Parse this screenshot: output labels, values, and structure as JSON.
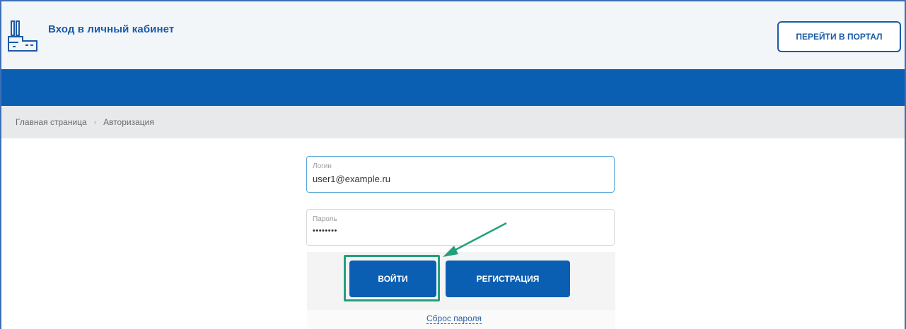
{
  "header": {
    "title": "Вход в личный кабинет",
    "portal_button": "ПЕРЕЙТИ В ПОРТАЛ"
  },
  "breadcrumb": {
    "home": "Главная страница",
    "separator": "›",
    "current": "Авторизация"
  },
  "form": {
    "login": {
      "label": "Логин",
      "value": "user1@example.ru"
    },
    "password": {
      "label": "Пароль",
      "value": "••••••••"
    },
    "login_button": "ВОЙТИ",
    "register_button": "РЕГИСТРАЦИЯ",
    "reset_link": "Сброс пароля"
  },
  "colors": {
    "brand_blue": "#0a5fb3",
    "highlight_green": "#23a07b",
    "title_blue": "#1b5aa6"
  },
  "icons": {
    "logo": "factory-icon",
    "annotation": "arrow-icon"
  }
}
